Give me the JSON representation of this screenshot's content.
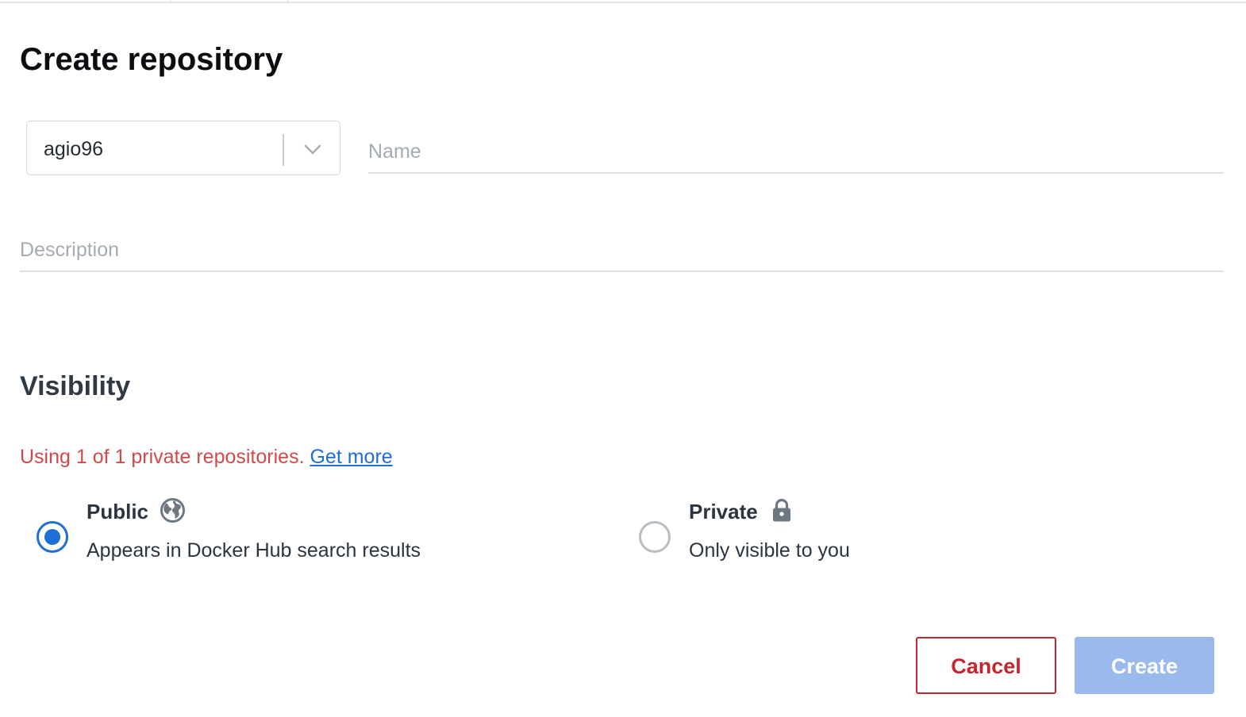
{
  "header": {
    "title": "Create repository"
  },
  "form": {
    "namespace": {
      "value": "agio96",
      "icon": "chevron-down-icon"
    },
    "name": {
      "value": "",
      "placeholder": "Name"
    },
    "description": {
      "value": "",
      "placeholder": "Description"
    }
  },
  "visibility": {
    "heading": "Visibility",
    "usage_text": "Using 1 of 1 private repositories.",
    "get_more_label": "Get more",
    "selected": "public",
    "options": [
      {
        "id": "public",
        "label": "Public",
        "description": "Appears in Docker Hub search results",
        "icon": "globe-icon"
      },
      {
        "id": "private",
        "label": "Private",
        "description": "Only visible to you",
        "icon": "lock-icon"
      }
    ]
  },
  "actions": {
    "cancel_label": "Cancel",
    "create_label": "Create"
  },
  "colors": {
    "accent": "#1f6ed4",
    "warning_text": "#d14a4a",
    "cancel": "#c5262e",
    "create_disabled": "#9ab9ec"
  }
}
